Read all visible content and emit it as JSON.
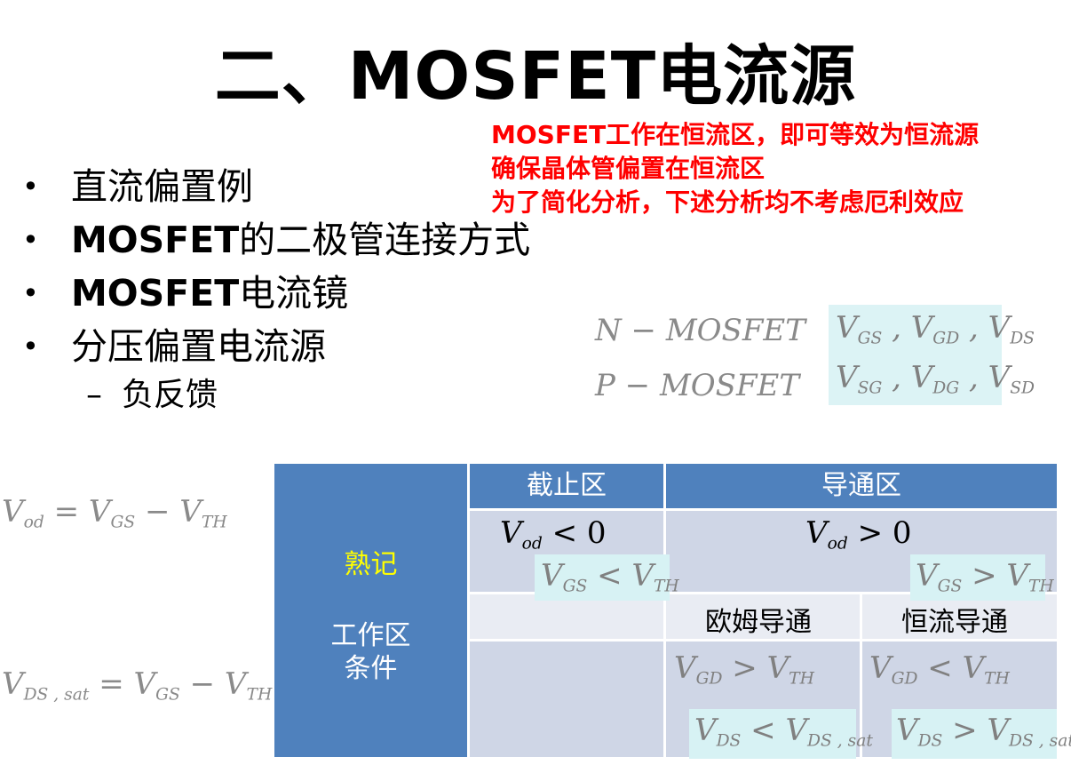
{
  "title": "二、MOSFET电流源",
  "notes": [
    "MOSFET工作在恒流区，即可等效为恒流源",
    "确保晶体管偏置在恒流区",
    "为了简化分析，下述分析均不考虑厄利效应"
  ],
  "bullets": {
    "b1": "直流偏置例",
    "b2_bold": "MOSFET",
    "b2_rest": "的二极管连接方式",
    "b3_bold": "MOSFET",
    "b3_rest": "电流镜",
    "b4": "分压偏置电流源",
    "sub_dash": "–",
    "sub1": "负反馈",
    "dot": "•"
  },
  "types": {
    "n_label": "N − MOSFET",
    "p_label": "P − MOSFET",
    "n_vars": [
      "V",
      "GS",
      " , V",
      "GD",
      " , V",
      "DS"
    ],
    "p_vars": [
      "V",
      "SG",
      " , V",
      "DG",
      " , V",
      "SD"
    ]
  },
  "formulas": {
    "vod_lhs": "V",
    "vod_lhs_sub": "od",
    "vod_eq": " = V",
    "vod_gs": "GS",
    "vod_minus": " − V",
    "vod_th": "TH",
    "vds_lhs": "V",
    "vds_lhs_sub": "DS , sat",
    "vds_eq": " = V",
    "vds_gs": "GS",
    "vds_minus": " − V",
    "vds_th": "TH"
  },
  "table": {
    "col_cutoff": "截止区",
    "col_on": "导通区",
    "side_memo": "熟记",
    "side_region": "工作区",
    "side_cond": "条件",
    "ohmic": "欧姆导通",
    "const": "恒流导通",
    "cut_vod": "V",
    "cut_vod_sub": "od",
    "cut_vod_rel": " < 0",
    "on_vod": "V",
    "on_vod_sub": "od",
    "on_vod_rel": " > 0",
    "cut_gs_rel": " < V",
    "on_gs_rel": " > V",
    "ohm_gd_rel": " > V",
    "con_gd_rel": " < V",
    "ohm_ds_rel": " < V",
    "con_ds_rel": " > V",
    "sub_gs": "GS",
    "sub_th": "TH",
    "sub_gd": "GD",
    "sub_ds": "DS",
    "sub_dssat": "DS , sat",
    "v": "V"
  },
  "colors": {
    "note_red": "#ff0000",
    "header_blue": "#4f81bd",
    "memo_yellow": "#ffff00"
  }
}
